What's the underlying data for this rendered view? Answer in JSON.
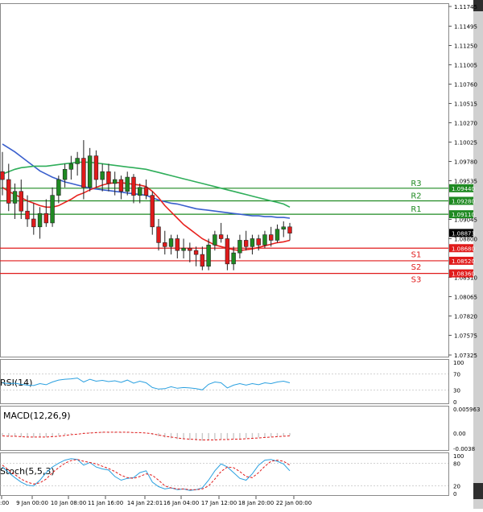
{
  "chart_data": {
    "type": "candlestick",
    "instrument_timeframe": "EURUSD-like hourly chart",
    "price_axis": {
      "ticks": [
        "1.11745",
        "1.11495",
        "1.11250",
        "1.11005",
        "1.10760",
        "1.10515",
        "1.10270",
        "1.10025",
        "1.09780",
        "1.09535",
        "1.09045",
        "1.08800",
        "1.08310",
        "1.08065",
        "1.07820",
        "1.07575",
        "1.07325"
      ],
      "ylim": [
        1.07325,
        1.11745
      ]
    },
    "x_axis": {
      "labels": [
        ":00",
        "9 Jan 00:00",
        "10 Jan 08:00",
        "11 Jan 16:00",
        "14 Jan 22:01",
        "16 Jan 04:00",
        "17 Jan 12:00",
        "18 Jan 20:00",
        "22 Jan 00:00"
      ]
    },
    "current_price": "1.08873",
    "levels": [
      {
        "name": "R3",
        "value": "1.09440",
        "kind": "resistance"
      },
      {
        "name": "R2",
        "value": "1.09280",
        "kind": "resistance"
      },
      {
        "name": "R1",
        "value": "1.09110",
        "kind": "resistance"
      },
      {
        "name": "S1",
        "value": "1.08680",
        "kind": "support"
      },
      {
        "name": "S2",
        "value": "1.08520",
        "kind": "support"
      },
      {
        "name": "S3",
        "value": "1.08360",
        "kind": "support"
      }
    ],
    "candles": [
      [
        1.0965,
        1.099,
        1.0935,
        1.0955
      ],
      [
        1.0955,
        1.0975,
        1.0915,
        1.0925
      ],
      [
        1.0925,
        1.095,
        1.0905,
        1.094
      ],
      [
        1.094,
        1.0955,
        1.0905,
        1.0915
      ],
      [
        1.0915,
        1.0935,
        1.0895,
        1.0905
      ],
      [
        1.0905,
        1.0925,
        1.0885,
        1.0895
      ],
      [
        1.0895,
        1.092,
        1.088,
        1.0912
      ],
      [
        1.0912,
        1.093,
        1.0895,
        1.09
      ],
      [
        1.09,
        1.0945,
        1.0895,
        1.0935
      ],
      [
        1.0935,
        1.096,
        1.0925,
        1.0955
      ],
      [
        1.0955,
        1.0975,
        1.0945,
        1.0968
      ],
      [
        1.0968,
        1.0985,
        1.0955,
        1.0975
      ],
      [
        1.0975,
        1.099,
        1.096,
        1.0982
      ],
      [
        1.0982,
        1.1005,
        1.093,
        1.0945
      ],
      [
        1.0945,
        1.0995,
        1.094,
        1.0985
      ],
      [
        1.0985,
        1.0992,
        1.0945,
        1.0955
      ],
      [
        1.0955,
        1.0975,
        1.094,
        1.0965
      ],
      [
        1.0965,
        1.0975,
        1.094,
        1.095
      ],
      [
        1.095,
        1.0965,
        1.0935,
        1.0955
      ],
      [
        1.0955,
        1.096,
        1.093,
        1.094
      ],
      [
        1.094,
        1.0965,
        1.0935,
        1.0958
      ],
      [
        1.0958,
        1.0962,
        1.0925,
        1.0935
      ],
      [
        1.0935,
        1.095,
        1.0925,
        1.0945
      ],
      [
        1.0945,
        1.0955,
        1.093,
        1.0935
      ],
      [
        1.0935,
        1.094,
        1.0885,
        1.0895
      ],
      [
        1.0895,
        1.0905,
        1.0865,
        1.0875
      ],
      [
        1.0875,
        1.089,
        1.086,
        1.087
      ],
      [
        1.087,
        1.0885,
        1.086,
        1.088
      ],
      [
        1.088,
        1.0885,
        1.0855,
        1.0865
      ],
      [
        1.0865,
        1.088,
        1.0855,
        1.0868
      ],
      [
        1.0868,
        1.0875,
        1.085,
        1.0865
      ],
      [
        1.0865,
        1.087,
        1.0845,
        1.086
      ],
      [
        1.086,
        1.087,
        1.084,
        1.0845
      ],
      [
        1.0845,
        1.088,
        1.084,
        1.0872
      ],
      [
        1.0872,
        1.089,
        1.0865,
        1.0885
      ],
      [
        1.0885,
        1.09,
        1.0875,
        1.088
      ],
      [
        1.088,
        1.0885,
        1.084,
        1.0848
      ],
      [
        1.0848,
        1.087,
        1.084,
        1.0862
      ],
      [
        1.0862,
        1.0885,
        1.0855,
        1.0878
      ],
      [
        1.0878,
        1.089,
        1.0865,
        1.087
      ],
      [
        1.087,
        1.0885,
        1.086,
        1.088
      ],
      [
        1.088,
        1.0885,
        1.0865,
        1.0872
      ],
      [
        1.0872,
        1.089,
        1.0868,
        1.0885
      ],
      [
        1.0885,
        1.0895,
        1.087,
        1.0878
      ],
      [
        1.0878,
        1.0898,
        1.0875,
        1.0892
      ],
      [
        1.0892,
        1.0902,
        1.0882,
        1.0895
      ],
      [
        1.0895,
        1.09,
        1.0878,
        1.0887
      ]
    ],
    "moving_averages": [
      {
        "color": "#3a5fcd",
        "values": [
          1.1,
          1.0995,
          1.099,
          1.0984,
          1.0978,
          1.0972,
          1.0966,
          1.0962,
          1.0958,
          1.0955,
          1.0952,
          1.095,
          1.0948,
          1.0946,
          1.0944,
          1.0943,
          1.0942,
          1.0941,
          1.094,
          1.0939,
          1.0938,
          1.0937,
          1.0936,
          1.0935,
          1.0932,
          1.0929,
          1.0927,
          1.0925,
          1.0924,
          1.0922,
          1.092,
          1.0918,
          1.0917,
          1.0916,
          1.0915,
          1.0914,
          1.0913,
          1.0912,
          1.0911,
          1.091,
          1.0909,
          1.0909,
          1.0908,
          1.0908,
          1.0907,
          1.0907,
          1.0906
        ]
      },
      {
        "color": "#2fae5a",
        "values": [
          1.0962,
          1.0965,
          1.0968,
          1.097,
          1.0971,
          1.0972,
          1.0972,
          1.0972,
          1.0973,
          1.0974,
          1.0975,
          1.0976,
          1.0977,
          1.0977,
          1.0977,
          1.0976,
          1.0975,
          1.0974,
          1.0973,
          1.0972,
          1.0971,
          1.097,
          1.0969,
          1.0968,
          1.0966,
          1.0964,
          1.0962,
          1.096,
          1.0958,
          1.0956,
          1.0954,
          1.0952,
          1.095,
          1.0948,
          1.0946,
          1.0944,
          1.0942,
          1.094,
          1.0938,
          1.0936,
          1.0934,
          1.0932,
          1.093,
          1.0928,
          1.0926,
          1.0924,
          1.092
        ]
      },
      {
        "color": "#e8231f",
        "values": [
          1.0945,
          1.094,
          1.0936,
          1.0932,
          1.0928,
          1.0925,
          1.0922,
          1.092,
          1.092,
          1.0922,
          1.0926,
          1.093,
          1.0935,
          1.0938,
          1.0942,
          1.0945,
          1.0948,
          1.095,
          1.0951,
          1.0951,
          1.095,
          1.0949,
          1.0948,
          1.0946,
          1.094,
          1.0932,
          1.0922,
          1.0914,
          1.0906,
          1.0898,
          1.0892,
          1.0886,
          1.088,
          1.0876,
          1.0872,
          1.087,
          1.0868,
          1.0866,
          1.0865,
          1.0866,
          1.0867,
          1.0869,
          1.0871,
          1.0873,
          1.0875,
          1.0876,
          1.0878
        ]
      }
    ],
    "rsi": {
      "label": "RSI(14)",
      "ticks": [
        "100",
        "70",
        "30",
        "0"
      ],
      "values": [
        48,
        46,
        47,
        44,
        42,
        41,
        46,
        43,
        50,
        55,
        57,
        58,
        60,
        50,
        57,
        52,
        54,
        51,
        53,
        49,
        55,
        47,
        52,
        48,
        36,
        32,
        33,
        38,
        34,
        36,
        35,
        33,
        30,
        44,
        50,
        48,
        35,
        42,
        46,
        42,
        46,
        43,
        48,
        46,
        50,
        52,
        48
      ]
    },
    "macd": {
      "label": "MACD(12,26,9)",
      "ticks": [
        "0.005963",
        "0.00",
        "-0.0038"
      ],
      "hist": [
        -0.0006,
        -0.0008,
        -0.0009,
        -0.001,
        -0.0011,
        -0.0011,
        -0.001,
        -0.001,
        -0.0008,
        -0.0006,
        -0.0004,
        -0.0002,
        0.0,
        0.0001,
        0.0002,
        0.0003,
        0.0003,
        0.0003,
        0.0003,
        0.0002,
        0.0002,
        0.0001,
        0.0001,
        0.0,
        -0.0004,
        -0.0008,
        -0.0011,
        -0.0013,
        -0.0015,
        -0.0016,
        -0.0017,
        -0.0018,
        -0.0019,
        -0.0018,
        -0.0017,
        -0.0016,
        -0.0016,
        -0.0015,
        -0.0014,
        -0.0013,
        -0.0012,
        -0.0011,
        -0.001,
        -0.0009,
        -0.0008,
        -0.0007,
        -0.0006
      ],
      "signal": [
        -0.0007,
        -0.0008,
        -0.0008,
        -0.0009,
        -0.001,
        -0.001,
        -0.001,
        -0.001,
        -0.0009,
        -0.0008,
        -0.0006,
        -0.0004,
        -0.0003,
        -0.0001,
        0.0,
        0.0001,
        0.0002,
        0.0002,
        0.0002,
        0.0002,
        0.0002,
        0.0001,
        0.0001,
        0.0,
        -0.0002,
        -0.0005,
        -0.0008,
        -0.001,
        -0.0012,
        -0.0014,
        -0.0015,
        -0.0016,
        -0.0017,
        -0.0017,
        -0.0017,
        -0.0016,
        -0.0016,
        -0.0015,
        -0.0015,
        -0.0014,
        -0.0013,
        -0.0012,
        -0.0011,
        -0.001,
        -0.0009,
        -0.0008,
        -0.0007
      ]
    },
    "stoch": {
      "label": "Stoch(5,5,3)",
      "ticks": [
        "100",
        "80",
        "20",
        "0"
      ],
      "main": [
        70,
        55,
        42,
        30,
        22,
        20,
        35,
        55,
        70,
        80,
        88,
        92,
        90,
        75,
        82,
        70,
        65,
        62,
        45,
        35,
        40,
        42,
        55,
        60,
        30,
        18,
        12,
        15,
        10,
        12,
        8,
        10,
        15,
        35,
        60,
        78,
        70,
        55,
        40,
        35,
        52,
        75,
        88,
        90,
        85,
        78,
        60
      ],
      "signal": [
        75,
        62,
        50,
        38,
        30,
        25,
        28,
        38,
        55,
        68,
        80,
        87,
        90,
        85,
        82,
        78,
        72,
        66,
        58,
        48,
        42,
        40,
        45,
        52,
        48,
        35,
        20,
        15,
        12,
        12,
        10,
        10,
        12,
        20,
        38,
        58,
        70,
        68,
        58,
        45,
        42,
        55,
        72,
        85,
        88,
        85,
        75
      ]
    }
  }
}
